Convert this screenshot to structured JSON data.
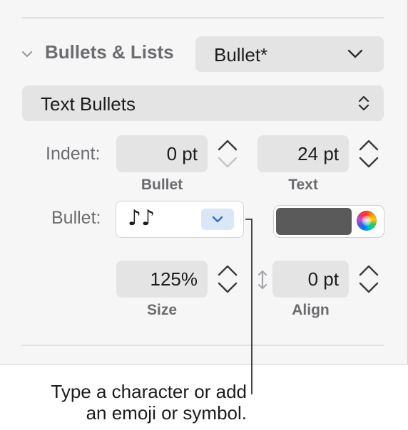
{
  "section": {
    "title": "Bullets & Lists",
    "style_popup": "Bullet*",
    "type_popup": "Text Bullets"
  },
  "indent": {
    "label": "Indent:",
    "bullet_value": "0 pt",
    "bullet_sublabel": "Bullet",
    "text_value": "24 pt",
    "text_sublabel": "Text"
  },
  "bullet": {
    "label": "Bullet:",
    "glyph": "♪♪",
    "color": "#5a5a5a"
  },
  "size_align": {
    "size_value": "125%",
    "size_sublabel": "Size",
    "align_value": "0 pt",
    "align_sublabel": "Align"
  },
  "callout": {
    "line1": "Type a character or add",
    "line2": "an emoji or symbol."
  },
  "icons": [
    "chevron-down-icon",
    "up-down-chevron-icon",
    "stepper-arrows-icon",
    "vertical-resize-icon",
    "color-wheel-icon"
  ],
  "colors": {
    "panel": "#f6f6f6",
    "control": "#e4e4e4",
    "accent": "#2b6fd6",
    "label": "#6c6c70"
  }
}
